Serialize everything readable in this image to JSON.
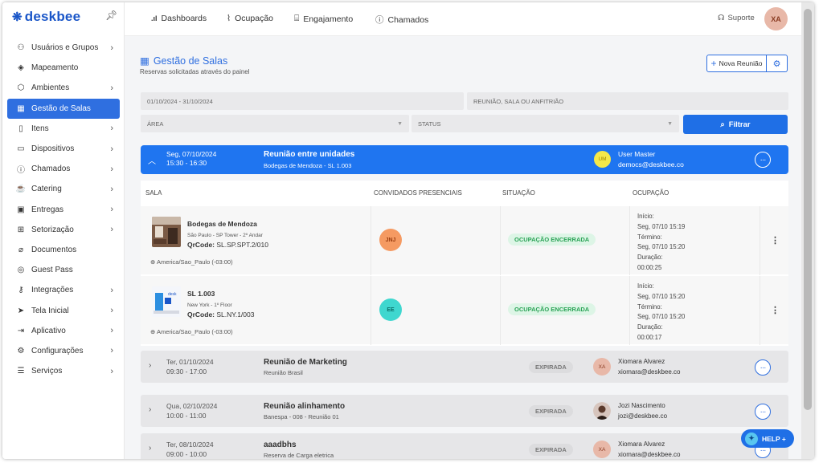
{
  "app": {
    "logo_text": "deskbee"
  },
  "sidebar": {
    "items": [
      {
        "label": "Usuários e Grupos",
        "icon": "users-icon",
        "glyph": "⚇",
        "chevron": true,
        "active": false
      },
      {
        "label": "Mapeamento",
        "icon": "layers-icon",
        "glyph": "◈",
        "chevron": false,
        "active": false
      },
      {
        "label": "Ambientes",
        "icon": "cube-icon",
        "glyph": "⬡",
        "chevron": true,
        "active": false
      },
      {
        "label": "Gestão de Salas",
        "icon": "calendar-icon",
        "glyph": "▦",
        "chevron": false,
        "active": true
      },
      {
        "label": "Itens",
        "icon": "clipboard-icon",
        "glyph": "▯",
        "chevron": true,
        "active": false
      },
      {
        "label": "Dispositivos",
        "icon": "devices-icon",
        "glyph": "▭",
        "chevron": true,
        "active": false
      },
      {
        "label": "Chamados",
        "icon": "alert-icon",
        "glyph": "ⓘ",
        "chevron": true,
        "active": false
      },
      {
        "label": "Catering",
        "icon": "cup-icon",
        "glyph": "☕",
        "chevron": true,
        "active": false
      },
      {
        "label": "Entregas",
        "icon": "box-icon",
        "glyph": "▣",
        "chevron": true,
        "active": false
      },
      {
        "label": "Setorização",
        "icon": "grid-icon",
        "glyph": "⊞",
        "chevron": true,
        "active": false
      },
      {
        "label": "Documentos",
        "icon": "paperclip-icon",
        "glyph": "⌀",
        "chevron": false,
        "active": false
      },
      {
        "label": "Guest Pass",
        "icon": "location-icon",
        "glyph": "◎",
        "chevron": false,
        "active": false
      },
      {
        "label": "Integrações",
        "icon": "key-icon",
        "glyph": "⚷",
        "chevron": true,
        "active": false
      },
      {
        "label": "Tela Inicial",
        "icon": "send-icon",
        "glyph": "➤",
        "chevron": true,
        "active": false
      },
      {
        "label": "Aplicativo",
        "icon": "login-icon",
        "glyph": "⇥",
        "chevron": true,
        "active": false
      },
      {
        "label": "Configurações",
        "icon": "gear-icon",
        "glyph": "⚙",
        "chevron": true,
        "active": false
      },
      {
        "label": "Serviços",
        "icon": "server-icon",
        "glyph": "☰",
        "chevron": true,
        "active": false
      }
    ]
  },
  "topnav": {
    "dashboards": "Dashboards",
    "ocupacao": "Ocupação",
    "engajamento": "Engajamento",
    "chamados": "Chamados",
    "suporte": "Suporte",
    "avatar_initials": "XA"
  },
  "page": {
    "title": "Gestão de Salas",
    "subtitle": "Reservas solicitadas através do painel",
    "new_button": "Nova Reunião"
  },
  "filters": {
    "date_range": "01/10/2024 - 31/10/2024",
    "search_placeholder": "REUNIÃO, SALA OU ANFITRIÃO",
    "area_placeholder": "ÁREA",
    "status_placeholder": "STATUS",
    "filter_button": "Filtrar"
  },
  "expanded": {
    "date": "Seg, 07/10/2024",
    "time": "15:30 - 16:30",
    "title": "Reunião entre unidades",
    "subtitle": "Bodegas de Mendoza - SL 1.003",
    "host_initials": "UM",
    "host_name": "User Master",
    "host_email": "democs@deskbee.co",
    "columns": [
      "SALA",
      "CONVIDADOS PRESENCIAIS",
      "SITUAÇÃO",
      "OCUPAÇÃO"
    ],
    "rows": [
      {
        "room": "Bodegas de Mendoza",
        "location": "São Paulo - SP Tower - 2º Andar",
        "qr_label": "QrCode:",
        "qr_value": "SL.SP.SPT.2/010",
        "timezone": "America/Sao_Paulo (-03:00)",
        "guest_initials": "JNJ",
        "guest_color": "#f59a62",
        "status": "OCUPAÇÃO ENCERRADA",
        "occ_start_label": "Início:",
        "occ_start": "Seg, 07/10 15:19",
        "occ_end_label": "Término:",
        "occ_end": "Seg, 07/10 15:20",
        "occ_dur_label": "Duração:",
        "occ_dur": "00:00:25"
      },
      {
        "room": "SL 1.003",
        "location": "New York - 1º Floor",
        "qr_label": "QrCode:",
        "qr_value": "SL.NY.1/003",
        "timezone": "America/Sao_Paulo (-03:00)",
        "guest_initials": "EE",
        "guest_color": "#3fd7cf",
        "status": "OCUPAÇÃO ENCERRADA",
        "occ_start_label": "Início:",
        "occ_start": "Seg, 07/10 15:20",
        "occ_end_label": "Término:",
        "occ_end": "Seg, 07/10 15:20",
        "occ_dur_label": "Duração:",
        "occ_dur": "00:00:17"
      }
    ]
  },
  "meetings": [
    {
      "date": "Ter, 01/10/2024",
      "time": "09:30 - 17:00",
      "title": "Reunião de Marketing",
      "subtitle": "Reunião Brasil",
      "status": "EXPIRADA",
      "host_initials": "XA",
      "host_name": "Xiomara Alvarez",
      "host_email": "xiomara@deskbee.co",
      "avatar_type": "initials"
    },
    {
      "date": "Qua, 02/10/2024",
      "time": "10:00 - 11:00",
      "title": "Reunião alinhamento",
      "subtitle": "Banespa - 008 - Reunião 01",
      "status": "EXPIRADA",
      "host_initials": "",
      "host_name": "Jozi Nascimento",
      "host_email": "jozi@deskbee.co",
      "avatar_type": "photo"
    },
    {
      "date": "Ter, 08/10/2024",
      "time": "09:00 - 10:00",
      "title": "aaadbhs",
      "subtitle": "Reserva de Carga eletrica",
      "status": "EXPIRADA",
      "host_initials": "XA",
      "host_name": "Xiomara Alvarez",
      "host_email": "xiomara@deskbee.co",
      "avatar_type": "initials"
    }
  ],
  "help": {
    "label": "HELP +"
  },
  "colors": {
    "primary": "#1f6fe6",
    "success_bg": "#ddf5e6",
    "success_text": "#2aa356"
  }
}
